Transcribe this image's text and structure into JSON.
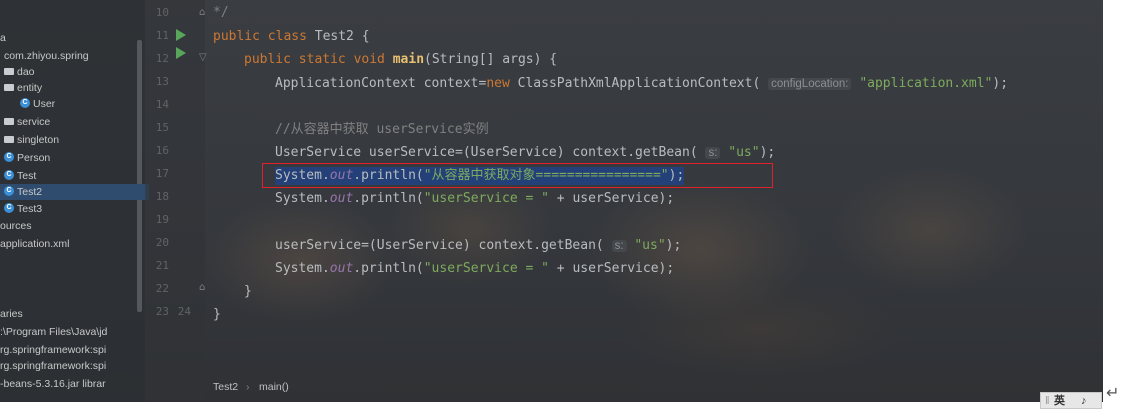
{
  "project_tree": {
    "rows": [
      {
        "label": "a",
        "icon": "none"
      },
      {
        "label": "com.zhiyou.spring",
        "icon": "none"
      },
      {
        "label": "dao",
        "icon": "folder-icon"
      },
      {
        "label": "entity",
        "icon": "folder-icon"
      },
      {
        "label": "User",
        "icon": "class-icon"
      },
      {
        "label": "service",
        "icon": "folder-icon"
      },
      {
        "label": "singleton",
        "icon": "folder-icon"
      },
      {
        "label": "Person",
        "icon": "class-icon"
      },
      {
        "label": "Test",
        "icon": "class-icon"
      },
      {
        "label": "Test2",
        "icon": "class-icon",
        "selected": true
      },
      {
        "label": "Test3",
        "icon": "class-icon"
      },
      {
        "label": "ources",
        "icon": "none"
      },
      {
        "label": "application.xml",
        "icon": "none"
      },
      {
        "label": "aries",
        "icon": "none"
      },
      {
        "label": ":\\Program Files\\Java\\jd",
        "icon": "none"
      },
      {
        "label": "rg.springframework:spi",
        "icon": "none"
      },
      {
        "label": "rg.springframework:spi",
        "icon": "none"
      },
      {
        "label": "-beans-5.3.16.jar  librar",
        "icon": "none"
      }
    ],
    "class_icon_letter": "C"
  },
  "gutter": {
    "line_numbers": [
      "10",
      "11",
      "12",
      "13",
      "14",
      "15",
      "16",
      "17",
      "18",
      "19",
      "20",
      "21",
      "22",
      "23",
      "24"
    ]
  },
  "code": {
    "l10": "*/",
    "l11_kw": "public class ",
    "l11_rest": "Test2 {",
    "l12_kw": "public static void ",
    "l12_fn": "main",
    "l12_rest": "(String[] args) {",
    "l13_a": "ApplicationContext context=",
    "l13_kw": "new ",
    "l13_b": "ClassPathXmlApplicationContext(",
    "l13_hint": "configLocation:",
    "l13_str": "\"application.xml\"",
    "l13_end": ");",
    "l15_comment": "//从容器中获取 userService实例",
    "l16_a": "UserService userService=(UserService) context.getBean(",
    "l16_hint": "s:",
    "l16_str": "\"us\"",
    "l16_end": ");",
    "l17_a": "System.",
    "l17_out": "out",
    "l17_b": ".println(",
    "l17_str": "\"从容器中获取对象================\"",
    "l17_end": ");",
    "l18_a": "System.",
    "l18_out": "out",
    "l18_b": ".println(",
    "l18_str": "\"userService = \"",
    "l18_end": " + userService);",
    "l20_a": "userService=(UserService) context.getBean(",
    "l20_hint": "s:",
    "l20_str": "\"us\"",
    "l20_end": ");",
    "l21_a": "System.",
    "l21_out": "out",
    "l21_b": ".println(",
    "l21_str": "\"userService = \"",
    "l21_end": " + userService);",
    "l22": "}",
    "l23": "}"
  },
  "breadcrumb": {
    "class": "Test2",
    "separator": "›",
    "method": "main()"
  },
  "ime": {
    "label": "英",
    "extra": "♪"
  },
  "enter_glyph": "↵",
  "colors": {
    "keyword": "#cc7832",
    "string": "#7eab5e",
    "highlight_box": "#e0202a",
    "selection": "#214283"
  }
}
